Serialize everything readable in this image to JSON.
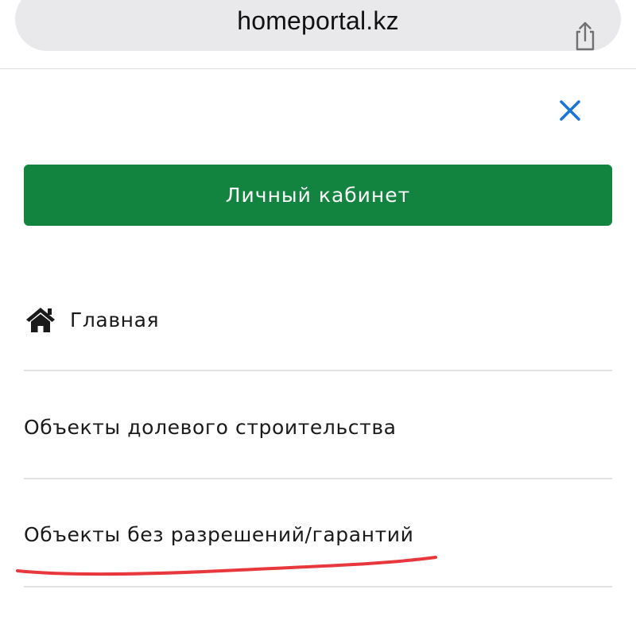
{
  "browser": {
    "url": "homeportal.kz"
  },
  "menu": {
    "cabinet_label": "Личный кабинет",
    "items": [
      {
        "label": "Главная",
        "icon": "home-icon"
      },
      {
        "label": "Объекты долевого строительства"
      },
      {
        "label": "Объекты без разрешений/гарантий"
      },
      {
        "label": ""
      }
    ]
  },
  "colors": {
    "accent_green": "#13843f",
    "close_blue": "#1a73d9",
    "annotation_red": "#e8383d"
  }
}
